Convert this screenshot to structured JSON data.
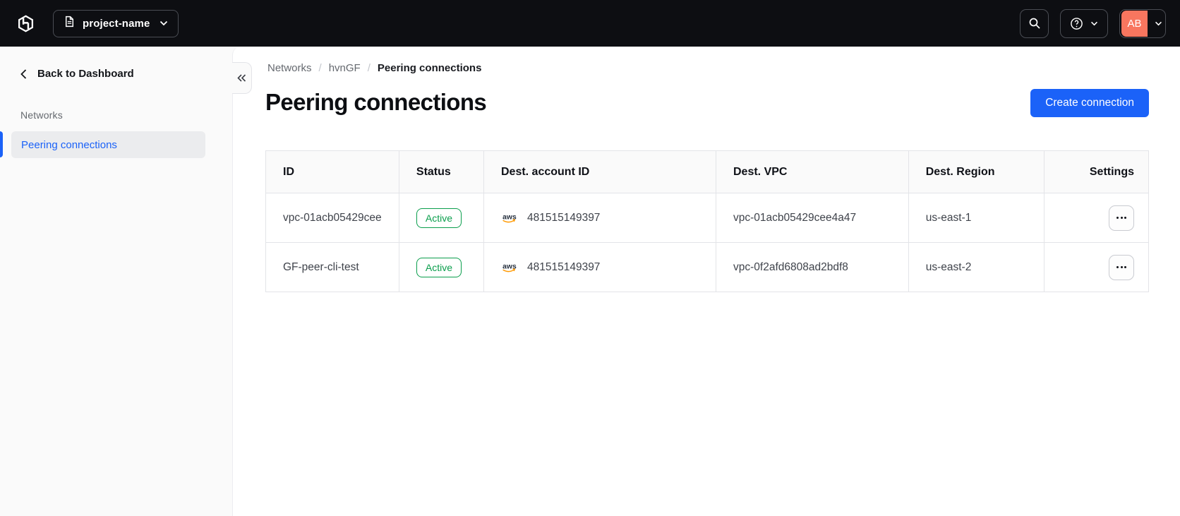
{
  "colors": {
    "topbar_bg": "#0d0e12",
    "accent": "#1b62f8",
    "green": "#0a9e4c",
    "avatar": "#f8765f",
    "aws_orange": "#ff9900",
    "aws_dark": "#252f3e"
  },
  "icons": {
    "logo": "hashicorp-hexagon-h",
    "project": "document",
    "search": "magnifier",
    "help": "question-circle",
    "collapse": "double-chevron-left",
    "back": "chevron-left",
    "row_menu": "ellipsis"
  },
  "topbar": {
    "project_selector": {
      "label": "project-name"
    },
    "avatar_initials": "AB"
  },
  "sidebar": {
    "back_label": "Back to Dashboard",
    "section_label": "Networks",
    "items": [
      {
        "label": "Peering connections",
        "active": true
      }
    ]
  },
  "breadcrumb": {
    "separator": "/",
    "items": [
      "Networks",
      "hvnGF",
      "Peering connections"
    ]
  },
  "page": {
    "title": "Peering connections",
    "create_button_label": "Create connection"
  },
  "table": {
    "columns": [
      "ID",
      "Status",
      "Dest. account ID",
      "Dest. VPC",
      "Dest. Region",
      "Settings"
    ],
    "rows": [
      {
        "id": "vpc-01acb05429cee",
        "status": "Active",
        "account_provider": "aws",
        "account_id": "481515149397",
        "vpc": "vpc-01acb05429cee4a47",
        "region": "us-east-1"
      },
      {
        "id": "GF-peer-cli-test",
        "status": "Active",
        "account_provider": "aws",
        "account_id": "481515149397",
        "vpc": "vpc-0f2afd6808ad2bdf8",
        "region": "us-east-2"
      }
    ]
  }
}
